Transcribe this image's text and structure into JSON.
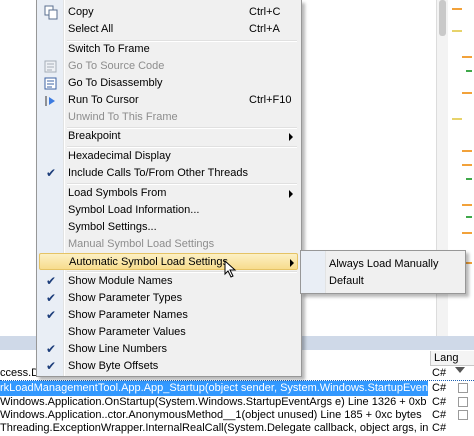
{
  "menu": {
    "items": [
      {
        "label": "Copy",
        "shortcut": "Ctrl+C",
        "icon": "copy-icon",
        "disabled": false
      },
      {
        "label": "Select All",
        "shortcut": "Ctrl+A",
        "disabled": false
      },
      {
        "label": "Switch To Frame",
        "disabled": false
      },
      {
        "label": "Go To Source Code",
        "icon": "go-to-source-icon",
        "disabled": true
      },
      {
        "label": "Go To Disassembly",
        "icon": "disassembly-icon",
        "disabled": false
      },
      {
        "label": "Run To Cursor",
        "shortcut": "Ctrl+F10",
        "icon": "run-to-cursor-icon",
        "disabled": false
      },
      {
        "label": "Unwind To This Frame",
        "disabled": true
      },
      {
        "label": "Breakpoint",
        "submenu": true
      },
      {
        "label": "Hexadecimal Display",
        "disabled": false
      },
      {
        "label": "Include Calls To/From Other Threads",
        "checked": true
      },
      {
        "label": "Load Symbols From",
        "submenu": true
      },
      {
        "label": "Symbol Load Information...",
        "disabled": false
      },
      {
        "label": "Symbol Settings...",
        "disabled": false
      },
      {
        "label": "Manual Symbol Load Settings",
        "disabled": true
      },
      {
        "label": "Automatic Symbol Load Settings",
        "submenu": true,
        "highlighted": true
      },
      {
        "label": "Show Module Names",
        "checked": true
      },
      {
        "label": "Show Parameter Types",
        "checked": true
      },
      {
        "label": "Show Parameter Names",
        "checked": true
      },
      {
        "label": "Show Parameter Values",
        "checked": false
      },
      {
        "label": "Show Line Numbers",
        "checked": true
      },
      {
        "label": "Show Byte Offsets",
        "checked": true
      }
    ]
  },
  "submenu": {
    "items": [
      {
        "label": "Always Load Manually"
      },
      {
        "label": "Default"
      }
    ]
  },
  "call_stack": {
    "column_language": "Lang",
    "rows": [
      {
        "text": "ccess.Dat",
        "lang": "C#"
      },
      {
        "text": "rkLoadManagementTool.App.App_Startup(object sender, System.Windows.StartupEventArgs e) + 0x3ec b",
        "lang": "C#",
        "selected": true
      },
      {
        "text": "Windows.Application.OnStartup(System.Windows.StartupEventArgs e) Line 1326 + 0xb bytes",
        "lang": "C#"
      },
      {
        "text": "Windows.Application..ctor.AnonymousMethod__1(object unused) Line 185 + 0xc bytes",
        "lang": "C#"
      },
      {
        "text": "Threading.ExceptionWrapper.InternalRealCall(System.Delegate callback, object args, int numArgs) + 0x",
        "lang": "C#"
      }
    ]
  },
  "colors": {
    "highlight": "#f7dc8d",
    "selection": "#3399ff",
    "menu_bg": "#f0f0f0"
  }
}
